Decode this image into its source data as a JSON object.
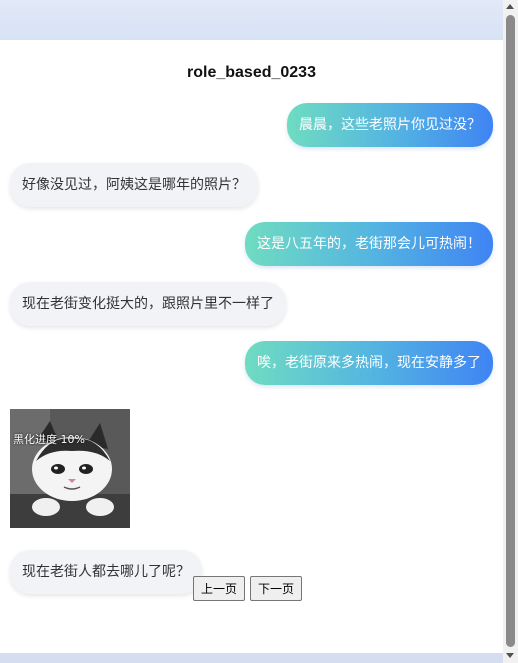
{
  "conversation": {
    "title": "role_based_0233",
    "messages": [
      {
        "side": "out",
        "text": "晨晨，这些老照片你见过没？"
      },
      {
        "side": "in",
        "text": "好像没见过，阿姨这是哪年的照片？"
      },
      {
        "side": "out",
        "text": "这是八五年的，老街那会儿可热闹！"
      },
      {
        "side": "in",
        "text": "现在老街变化挺大的，跟照片里不一样了"
      },
      {
        "side": "out",
        "text": "唉，老街原来多热闹，现在安静多了"
      },
      {
        "side": "in",
        "text": "现在老街人都去哪儿了呢？"
      }
    ],
    "sticker": {
      "caption": "黑化进度 10%",
      "icon": "crying-cat-sticker"
    }
  },
  "pager": {
    "prev_label": "上一页",
    "next_label": "下一页"
  },
  "colors": {
    "out_start": "#6fdcc1",
    "out_end": "#3f84f4",
    "in_bg": "#f1f3f7"
  }
}
